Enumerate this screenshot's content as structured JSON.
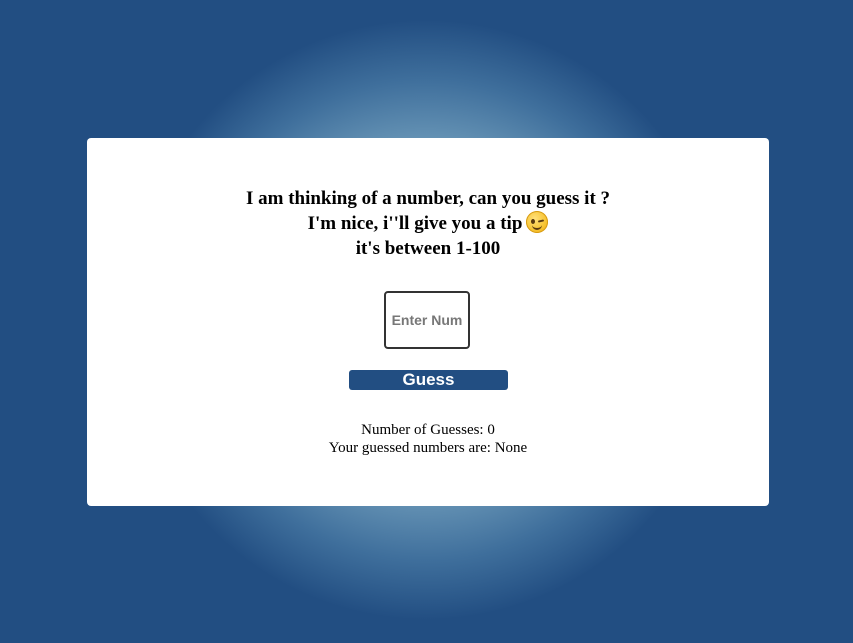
{
  "heading": {
    "line1": "I am thinking of a number, can you guess it ?",
    "line2": "I'm nice, i''ll give you a tip",
    "line2_icon": "winking-face-emoji",
    "line3": "it's between 1-100"
  },
  "input": {
    "placeholder": "Enter Num",
    "value": ""
  },
  "guess_button": {
    "label": "Guess"
  },
  "stats": {
    "guess_count_label": "Number of Guesses:",
    "guess_count": "0",
    "guessed_numbers_label": "Your guessed numbers are:",
    "guessed_numbers": "None"
  },
  "colors": {
    "page_background": "#224e82",
    "button_background": "#224e82",
    "card_background": "#ffffff"
  }
}
